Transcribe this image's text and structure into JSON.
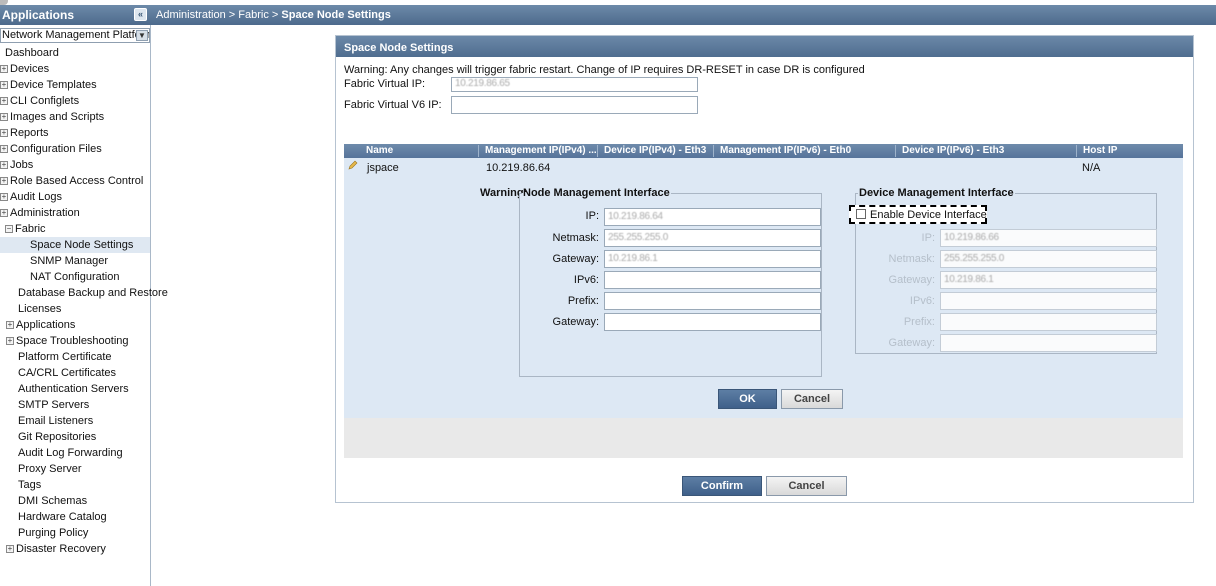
{
  "topbar": {
    "app_title": "Applications",
    "collapse_icon": "«",
    "breadcrumb": {
      "item1": "Administration",
      "sep1": ">",
      "item2": "Fabric",
      "sep2": ">",
      "current": "Space Node Settings"
    }
  },
  "sidebar": {
    "platform_select": {
      "value": "Network Management Platform"
    },
    "items": [
      {
        "label": "Dashboard"
      },
      {
        "label": "Devices"
      },
      {
        "label": "Device Templates"
      },
      {
        "label": "CLI Configlets"
      },
      {
        "label": "Images and Scripts"
      },
      {
        "label": "Reports"
      },
      {
        "label": "Configuration Files"
      },
      {
        "label": "Jobs"
      },
      {
        "label": "Role Based Access Control"
      },
      {
        "label": "Audit Logs"
      },
      {
        "label": "Administration"
      },
      {
        "label": "Fabric"
      },
      {
        "label": "Space Node Settings"
      },
      {
        "label": "SNMP Manager"
      },
      {
        "label": "NAT Configuration"
      },
      {
        "label": "Database Backup and Restore"
      },
      {
        "label": "Licenses"
      },
      {
        "label": "Applications"
      },
      {
        "label": "Space Troubleshooting"
      },
      {
        "label": "Platform Certificate"
      },
      {
        "label": "CA/CRL Certificates"
      },
      {
        "label": "Authentication Servers"
      },
      {
        "label": "SMTP Servers"
      },
      {
        "label": "Email Listeners"
      },
      {
        "label": "Git Repositories"
      },
      {
        "label": "Audit Log Forwarding"
      },
      {
        "label": "Proxy Server"
      },
      {
        "label": "Tags"
      },
      {
        "label": "DMI Schemas"
      },
      {
        "label": "Hardware Catalog"
      },
      {
        "label": "Purging Policy"
      },
      {
        "label": "Disaster Recovery"
      }
    ],
    "expander_plus": "+",
    "expander_minus": "−"
  },
  "panel": {
    "title": "Space Node Settings",
    "warning": "Warning: Any changes will trigger fabric restart. Change of IP requires DR-RESET in case DR is configured",
    "fabric_vip_label": "Fabric Virtual IP:",
    "fabric_vip_value": "10.219.86.65",
    "fabric_v6_label": "Fabric Virtual V6 IP:",
    "fabric_v6_value": ""
  },
  "grid": {
    "headers": [
      "Name",
      "Management IP(IPv4) ...",
      "Device IP(IPv4) - Eth3",
      "Management IP(IPv6) - Eth0",
      "Device IP(IPv6) - Eth3",
      "Host IP"
    ],
    "row": {
      "name": "jspace",
      "mgmt_ipv4": "10.219.86.64",
      "host_ip": "N/A"
    },
    "warning_prefix": "Warning:",
    "node_mgmt": {
      "legend": "Node Management Interface",
      "ip_label": "IP:",
      "ip_value": "10.219.86.64",
      "netmask_label": "Netmask:",
      "netmask_value": "255.255.255.0",
      "gateway_label": "Gateway:",
      "gateway_value": "10.219.86.1",
      "ipv6_label": "IPv6:",
      "ipv6_value": "",
      "prefix_label": "Prefix:",
      "prefix_value": "",
      "gateway6_label": "Gateway:",
      "gateway6_value": ""
    },
    "device_mgmt": {
      "legend": "Device Management Interface",
      "enable_label": "Enable Device Interface",
      "ip_label": "IP:",
      "ip_value": "10.219.86.66",
      "netmask_label": "Netmask:",
      "netmask_value": "255.255.255.0",
      "gateway_label": "Gateway:",
      "gateway_value": "10.219.86.1",
      "ipv6_label": "IPv6:",
      "ipv6_value": "",
      "prefix_label": "Prefix:",
      "prefix_value": "",
      "gateway6_label": "Gateway:",
      "gateway6_value": ""
    },
    "ok_label": "OK",
    "cancel_label": "Cancel"
  },
  "footer": {
    "confirm_label": "Confirm",
    "cancel_label": "Cancel"
  },
  "colors": {
    "header_blue": "#4f6d8f",
    "panel_bg": "#dde8f4",
    "primary_button": "#3f608a"
  }
}
